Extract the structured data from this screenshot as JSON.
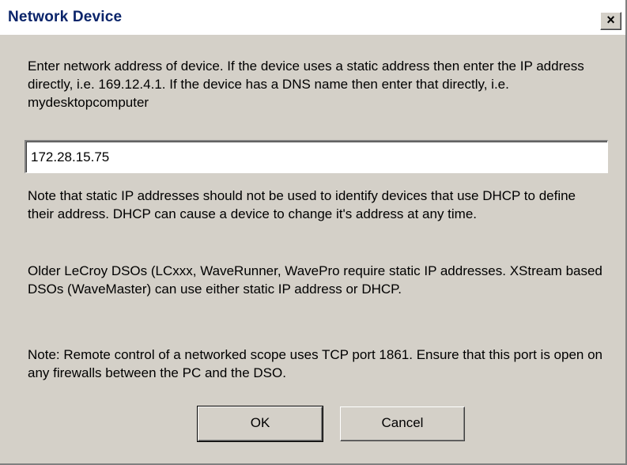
{
  "window": {
    "title": "Network Device",
    "close_glyph": "×",
    "close_icon": "close-icon"
  },
  "instructions": "Enter network address of device. If the device uses a static address then enter the IP address directly, i.e. 169.12.4.1. If the device has a DNS name then enter that directly, i.e. mydesktopcomputer",
  "address_input": {
    "value": "172.28.15.75"
  },
  "notes": {
    "dhcp_note": "Note that static IP addresses should not be used to identify devices that use DHCP to define their address. DHCP can cause a device to change it's address at any time.",
    "dso_note": "Older LeCroy DSOs (LCxxx, WaveRunner, WavePro require static IP addresses. XStream based DSOs (WaveMaster) can use either static IP address or DHCP.",
    "port_note": "Note: Remote control of a networked scope uses TCP port 1861. Ensure that this port is open on any firewalls between the PC and the DSO."
  },
  "buttons": {
    "ok_label": "OK",
    "cancel_label": "Cancel"
  },
  "colors": {
    "dialog_background": "#d4d0c8",
    "title_text": "#0a246a"
  }
}
